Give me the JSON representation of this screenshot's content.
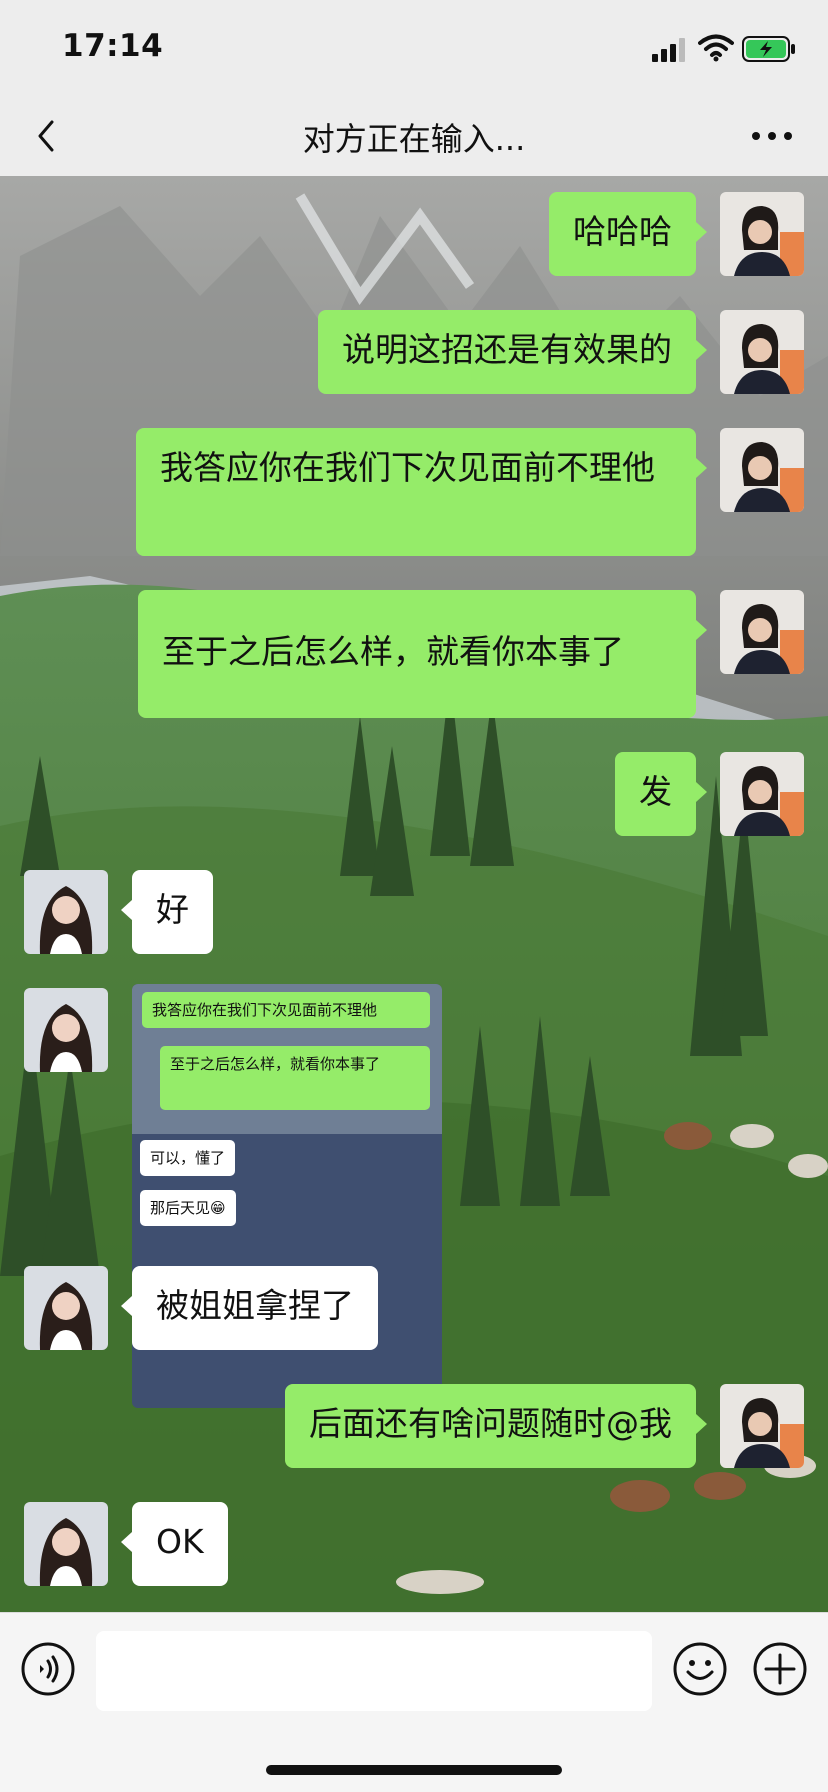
{
  "status_bar": {
    "time": "17:14"
  },
  "nav": {
    "title": "对方正在输入..."
  },
  "messages": [
    {
      "side": "mine",
      "text": "哈哈哈"
    },
    {
      "side": "mine",
      "text": "说明这招还是有效果的"
    },
    {
      "side": "mine",
      "text": "我答应你在我们下次见面前不理他"
    },
    {
      "side": "mine",
      "text": "至于之后怎么样，就看你本事了"
    },
    {
      "side": "mine",
      "text": "发"
    },
    {
      "side": "theirs",
      "text": "好"
    },
    {
      "side": "theirs",
      "type": "image",
      "screenshot": {
        "line1": "我答应你在我们下次见面前不理他",
        "line2": "至于之后怎么样，就看你本事了",
        "line3": "可以，懂了",
        "line4": "那后天见😁"
      }
    },
    {
      "side": "theirs",
      "text": "被姐姐拿捏了"
    },
    {
      "side": "mine",
      "text": "后面还有啥问题随时@我"
    },
    {
      "side": "theirs",
      "text": "OK"
    }
  ],
  "input": {
    "placeholder": ""
  },
  "colors": {
    "mine_bubble": "#95ec69",
    "theirs_bubble": "#ffffff",
    "background": "#ededed"
  },
  "icons": [
    "back-icon",
    "more-icon",
    "voice-icon",
    "emoji-icon",
    "plus-icon",
    "signal-icon",
    "wifi-icon",
    "battery-icon"
  ]
}
